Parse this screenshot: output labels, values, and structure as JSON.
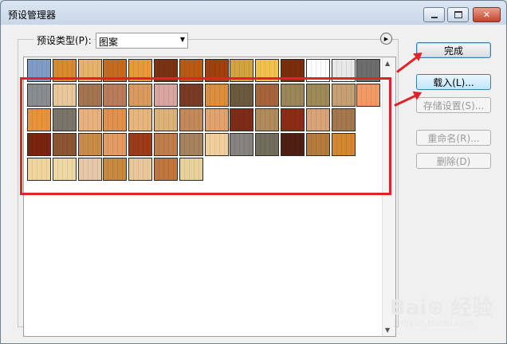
{
  "window": {
    "title": "预设管理器"
  },
  "preset": {
    "type_label": "预设类型(P):",
    "type_value": "图案"
  },
  "buttons": {
    "done": "完成",
    "load": "载入(L)...",
    "save": "存储设置(S)...",
    "rename": "重命名(R)...",
    "delete": "删除(D)"
  },
  "watermark": {
    "brand": "Bai⊕ 经验",
    "url": "jingyan.baidu.com"
  },
  "swatches": {
    "row1": [
      "#7f9dc4",
      "#d98a2e",
      "#e6b368",
      "#c46b1f",
      "#e89a3a",
      "#7a3312",
      "#b85a12",
      "#a0400f",
      "#d3a33f",
      "#f0c24d",
      "#7b2d0c",
      "#fdfdfd",
      "#e8e8e8",
      "#6d6d6d"
    ],
    "row2": [
      "#8a8d8f",
      "#e8c89b",
      "#a47450",
      "#b87c5b",
      "#d99a5e",
      "#d8a5a0",
      "#7a3b24",
      "#d98f3d",
      "#6b5a3e",
      "#a6643c",
      "#9b8658",
      "#9d8a56",
      "#c69f73",
      "#f19a63"
    ],
    "row3": [
      "#e99239",
      "#7b746b",
      "#e8b07e",
      "#e0914d",
      "#e7b67d",
      "#dcb27a",
      "#c4895b",
      "#e0a26f",
      "#7e2b17",
      "#b18a5c",
      "#8b2d14",
      "#d7a377",
      "#a5774d"
    ],
    "row4": [
      "#7c230f",
      "#8c5632",
      "#c98c48",
      "#e29b64",
      "#9c3b1a",
      "#c07e4f",
      "#a4835e",
      "#f0cf9c",
      "#868280",
      "#706d5d",
      "#4e1f12",
      "#b57b3c",
      "#d28733"
    ],
    "row5": [
      "#f0d59c",
      "#eed9a5",
      "#e6c7a7",
      "#c7883f",
      "#e9c79b",
      "#c0763c",
      "#e7d29b"
    ]
  }
}
